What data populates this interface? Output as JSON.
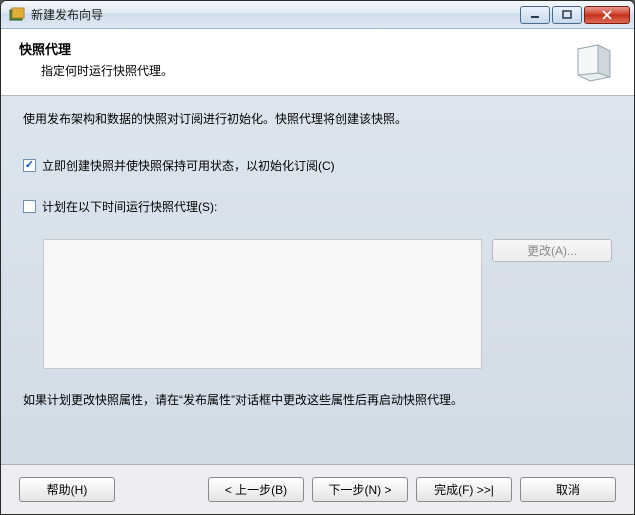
{
  "window": {
    "title": "新建发布向导"
  },
  "header": {
    "title": "快照代理",
    "subtitle": "指定何时运行快照代理。"
  },
  "body": {
    "description": "使用发布架构和数据的快照对订阅进行初始化。快照代理将创建该快照。",
    "checkbox_create_now_label": "立即创建快照并使快照保持可用状态，以初始化订阅(C)",
    "checkbox_create_now_checked": true,
    "checkbox_schedule_label": "计划在以下时间运行快照代理(S):",
    "checkbox_schedule_checked": false,
    "change_button": "更改(A)...",
    "note": "如果计划更改快照属性，请在“发布属性”对话框中更改这些属性后再启动快照代理。"
  },
  "footer": {
    "help": "帮助(H)",
    "back": "< 上一步(B)",
    "next": "下一步(N) >",
    "finish": "完成(F) >>|",
    "cancel": "取消"
  }
}
